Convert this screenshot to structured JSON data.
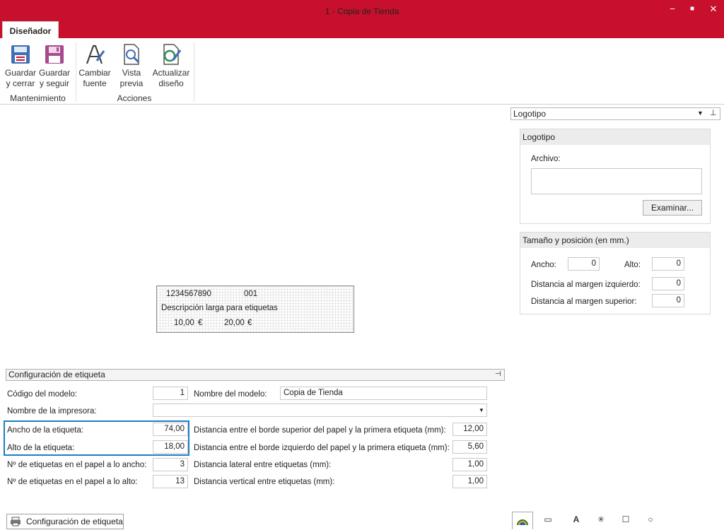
{
  "window": {
    "title": "1 - Copia de Tienda",
    "minimize": "−",
    "maximize": "■",
    "close": "✕"
  },
  "ribbon": {
    "tab": "Diseñador",
    "buttons": [
      {
        "line1": "Guardar",
        "line2": "y cerrar"
      },
      {
        "line1": "Guardar",
        "line2": "y seguir"
      },
      {
        "line1": "Cambiar",
        "line2": "fuente"
      },
      {
        "line1": "Vista",
        "line2": "previa"
      },
      {
        "line1": "Actualizar",
        "line2": "diseño"
      }
    ],
    "groups": [
      "Mantenimiento",
      "Acciones"
    ]
  },
  "properties_panel": {
    "selector": "Logotipo",
    "logo_box": {
      "title": "Logotipo",
      "file_label": "Archivo:",
      "file_value": "",
      "browse_button": "Examinar..."
    },
    "size_box": {
      "title": "Tamaño y posición (en mm.)",
      "width_label": "Ancho:",
      "width_value": "0",
      "height_label": "Alto:",
      "height_value": "0",
      "left_margin_label": "Distancia al margen izquierdo:",
      "left_margin_value": "0",
      "top_margin_label": "Distancia al margen superior:",
      "top_margin_value": "0"
    }
  },
  "label_preview": {
    "barcode": "1234567890",
    "code": "001",
    "description": "Descripción larga para etiquetas",
    "price1": "10,00",
    "currency1": "€",
    "price2": "20,00",
    "currency2": "€"
  },
  "config": {
    "section_title": "Configuración de etiqueta",
    "model_code_label": "Código del modelo:",
    "model_code_value": "1",
    "model_name_label": "Nombre del modelo:",
    "model_name_value": "Copia de Tienda",
    "printer_label": "Nombre de la impresora:",
    "printer_value": "",
    "label_width_label": "Ancho de la etiqueta:",
    "label_width_value": "74,00",
    "label_height_label": "Alto de la etiqueta:",
    "label_height_value": "18,00",
    "per_width_label": "Nº de  etiquetas en el papel a lo ancho:",
    "per_width_value": "3",
    "per_height_label": "Nº de  etiquetas en el papel a lo alto:",
    "per_height_value": "13",
    "top_edge_label": "Distancia entre el borde superior del papel y la primera etiqueta (mm):",
    "top_edge_value": "12,00",
    "left_edge_label": "Distancia entre el borde izquierdo del papel y la primera etiqueta (mm):",
    "left_edge_value": "5,60",
    "lateral_label": "Distancia lateral entre etiquetas (mm):",
    "lateral_value": "1,00",
    "vertical_label": "Distancia vertical  entre etiquetas (mm):",
    "vertical_value": "1,00"
  },
  "bottom_tab": "Configuración de etiqueta",
  "colors": {
    "title_bar": "#c8102e",
    "highlight": "#1b7fc1"
  }
}
